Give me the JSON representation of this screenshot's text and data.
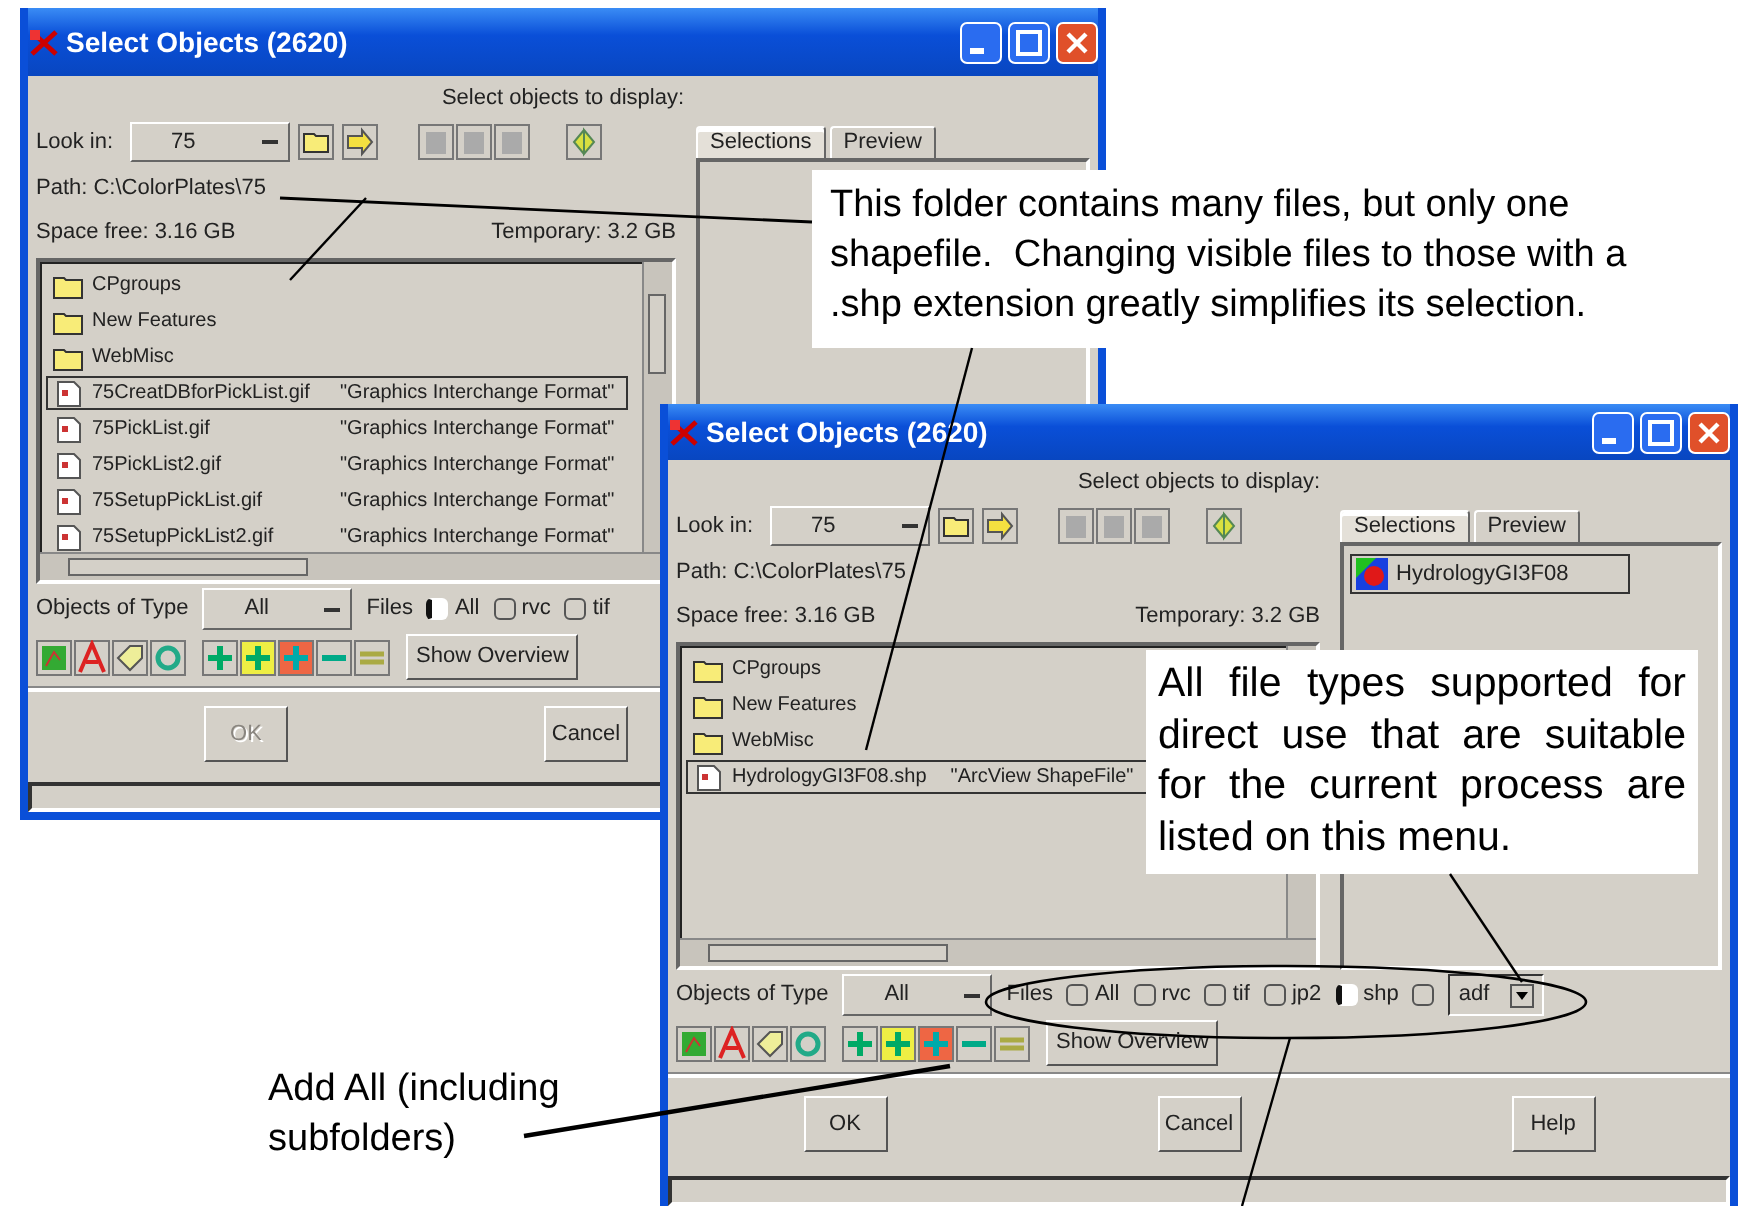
{
  "windows": [
    {
      "title": "Select Objects (2620)",
      "heading": "Select objects to display:",
      "look_in": {
        "label": "Look in:",
        "value": "75"
      },
      "path": "Path: C:\\ColorPlates\\75",
      "space_free": "Space free:  3.16 GB",
      "temporary": "Temporary: 3.2 GB",
      "tabs": [
        {
          "label": "Selections",
          "selected": true
        },
        {
          "label": "Preview",
          "selected": false
        }
      ],
      "file_list": [
        {
          "kind": "folder",
          "name": "CPgroups",
          "selected": false
        },
        {
          "kind": "folder",
          "name": "New Features",
          "selected": false
        },
        {
          "kind": "folder",
          "name": "WebMisc",
          "selected": false
        },
        {
          "kind": "file",
          "name": "75CreatDBforPickList.gif",
          "type": "\"Graphics Interchange Format\"",
          "selected": true
        },
        {
          "kind": "file",
          "name": "75PickList.gif",
          "type": "\"Graphics Interchange Format\"",
          "selected": false
        },
        {
          "kind": "file",
          "name": "75PickList2.gif",
          "type": "\"Graphics Interchange Format\"",
          "selected": false
        },
        {
          "kind": "file",
          "name": "75SetupPickList.gif",
          "type": "\"Graphics Interchange Format\"",
          "selected": false
        },
        {
          "kind": "file",
          "name": "75SetupPickList2.gif",
          "type": "\"Graphics Interchange Format\"",
          "selected": false
        }
      ],
      "objects_of_type": {
        "label": "Objects of Type",
        "value": "All"
      },
      "files_filter": {
        "label": "Files",
        "options": [
          {
            "label": "All",
            "selected": true
          },
          {
            "label": "rvc",
            "selected": false
          },
          {
            "label": "tif",
            "selected": false
          }
        ]
      },
      "overview_button": "Show Overview",
      "buttons": [
        {
          "label": "OK",
          "disabled": true
        },
        {
          "label": "Cancel",
          "disabled": false
        }
      ]
    },
    {
      "title": "Select Objects (2620)",
      "heading": "Select objects to display:",
      "look_in": {
        "label": "Look in:",
        "value": "75"
      },
      "path": "Path: C:\\ColorPlates\\75",
      "space_free": "Space free:  3.16 GB",
      "temporary": "Temporary: 3.2 GB",
      "tabs": [
        {
          "label": "Selections",
          "selected": true
        },
        {
          "label": "Preview",
          "selected": false
        }
      ],
      "file_list": [
        {
          "kind": "folder",
          "name": "CPgroups",
          "selected": false
        },
        {
          "kind": "folder",
          "name": "New Features",
          "selected": false
        },
        {
          "kind": "folder",
          "name": "WebMisc",
          "selected": false
        },
        {
          "kind": "file",
          "name": "HydrologyGI3F08.shp",
          "type": "\"ArcView ShapeFile\"",
          "selected": true
        }
      ],
      "selections": [
        "HydrologyGI3F08"
      ],
      "objects_of_type": {
        "label": "Objects of Type",
        "value": "All"
      },
      "files_filter": {
        "label": "Files",
        "options": [
          {
            "label": "All",
            "selected": false
          },
          {
            "label": "rvc",
            "selected": false
          },
          {
            "label": "tif",
            "selected": false
          },
          {
            "label": "jp2",
            "selected": false
          },
          {
            "label": "shp",
            "selected": true
          }
        ],
        "other": {
          "value": "adf",
          "selected": false
        }
      },
      "overview_button": "Show Overview",
      "buttons": [
        {
          "label": "OK",
          "disabled": false
        },
        {
          "label": "Cancel",
          "disabled": false
        },
        {
          "label": "Help",
          "disabled": false
        }
      ]
    }
  ],
  "callouts": [
    {
      "text": "This folder contains many files, but only one shapefile.  Changing visible files to those with a .shp extension greatly simplifies its selection."
    },
    {
      "text": "All file types supported for direct use that are suitable for the current process are listed on this menu."
    },
    {
      "text": "Add All (including subfolders)"
    }
  ]
}
